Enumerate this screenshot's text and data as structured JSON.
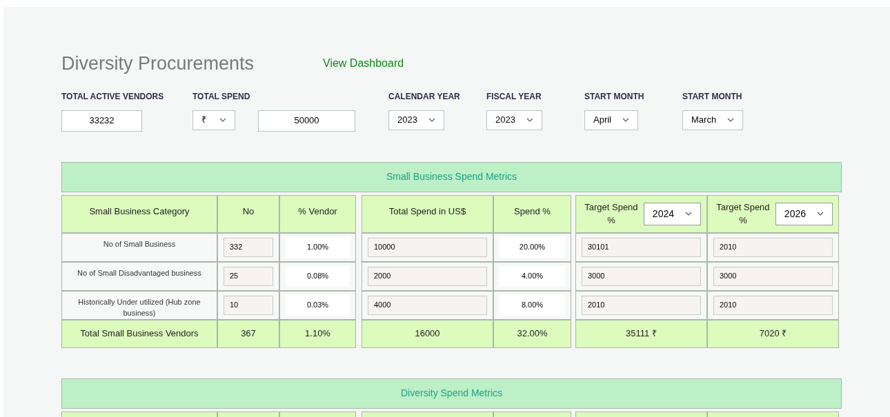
{
  "title": "Diversity Procurements",
  "link": "View Dashboard",
  "filters": [
    {
      "label": "TOTAL ACTIVE VENDORS",
      "controls": [
        {
          "kind": "input",
          "value": "33232"
        }
      ]
    },
    {
      "label": "TOTAL SPEND",
      "controls": [
        {
          "kind": "select",
          "value": "₹"
        },
        {
          "kind": "input",
          "value": "50000"
        }
      ]
    },
    {
      "label": "CALENDAR YEAR",
      "controls": [
        {
          "kind": "select",
          "value": "2023"
        }
      ]
    },
    {
      "label": "FISCAL YEAR",
      "controls": [
        {
          "kind": "select",
          "value": "2023"
        }
      ]
    },
    {
      "label": "START MONTH",
      "controls": [
        {
          "kind": "select",
          "value": "April"
        }
      ]
    },
    {
      "label": "START MONTH",
      "controls": [
        {
          "kind": "select",
          "value": "March"
        }
      ]
    }
  ],
  "sections": [
    {
      "title": "Small Business Spend Metrics",
      "columns": [
        {
          "label": "Small Business Category"
        },
        {
          "label": "No"
        },
        {
          "label": "% Vendor"
        },
        {
          "label": "Total Spend in US$"
        },
        {
          "label": "Spend %"
        },
        {
          "label": "Target Spend %",
          "select": "2024"
        },
        {
          "label": "Target Spend %",
          "select": "2026"
        }
      ],
      "rows": [
        {
          "category": "No of Small Business",
          "no": "332",
          "vendor_pct": "1.00%",
          "spend": "10000",
          "spend_pct": "20.00%",
          "target_1": "30101",
          "target_2": "2010"
        },
        {
          "category": "No of Small Disadvantaged business",
          "no": "25",
          "vendor_pct": "0.08%",
          "spend": "2000",
          "spend_pct": "4.00%",
          "target_1": "3000",
          "target_2": "3000"
        },
        {
          "category": "Historically Under utilized (Hub zone business)",
          "no": "10",
          "vendor_pct": "0.03%",
          "spend": "4000",
          "spend_pct": "8.00%",
          "target_1": "2010",
          "target_2": "2010"
        }
      ],
      "total": {
        "category": "Total Small Business Vendors",
        "no": "367",
        "vendor_pct": "1.10%",
        "spend": "16000",
        "spend_pct": "32.00%",
        "target_1": "35111 ₹",
        "target_2": "7020 ₹"
      }
    },
    {
      "title": "Diversity Spend Metrics"
    }
  ]
}
